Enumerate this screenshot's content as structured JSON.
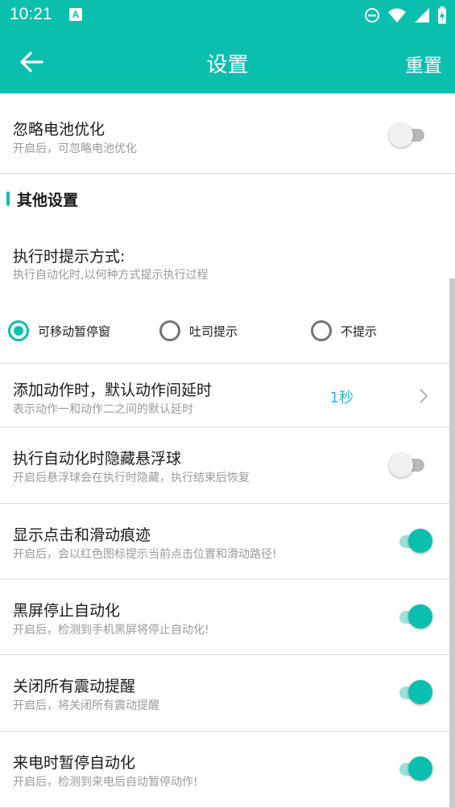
{
  "status_bar": {
    "time": "10:21",
    "notification_icon": "A"
  },
  "app_bar": {
    "title": "设置",
    "action": "重置"
  },
  "items": {
    "battery": {
      "title": "忽略电池优化",
      "subtitle": "开启后，可忽略电池优化",
      "enabled": false
    },
    "section_title": "其他设置",
    "prompt_mode": {
      "title": "执行时提示方式:",
      "subtitle": "执行自动化时,以何种方式提示执行过程",
      "options": [
        "可移动暂停窗",
        "吐司提示",
        "不提示"
      ],
      "selected": "可移动暂停窗"
    },
    "delay": {
      "title": "添加动作时，默认动作间延时",
      "subtitle": "表示动作一和动作二之间的默认延时",
      "value": "1秒"
    },
    "hide_ball": {
      "title": "执行自动化时隐藏悬浮球",
      "subtitle": "开启后悬浮球会在执行时隐藏，执行结束后恢复",
      "enabled": false
    },
    "show_trace": {
      "title": "显示点击和滑动痕迹",
      "subtitle": "开启后，会以红色图标提示当前点击位置和滑动路径!",
      "enabled": true
    },
    "screen_off": {
      "title": "黑屏停止自动化",
      "subtitle": "开启后，检测到手机黑屏将停止自动化!",
      "enabled": true
    },
    "vibration": {
      "title": "关闭所有震动提醒",
      "subtitle": "开启后，将关闭所有震动提醒",
      "enabled": true
    },
    "incoming_call": {
      "title": "来电时暂停自动化",
      "subtitle": "开启后，检测到来电后自动暂停动作!",
      "enabled": true
    }
  },
  "colors": {
    "accent": "#0bbfaf",
    "value_text": "#2bb6c6"
  }
}
